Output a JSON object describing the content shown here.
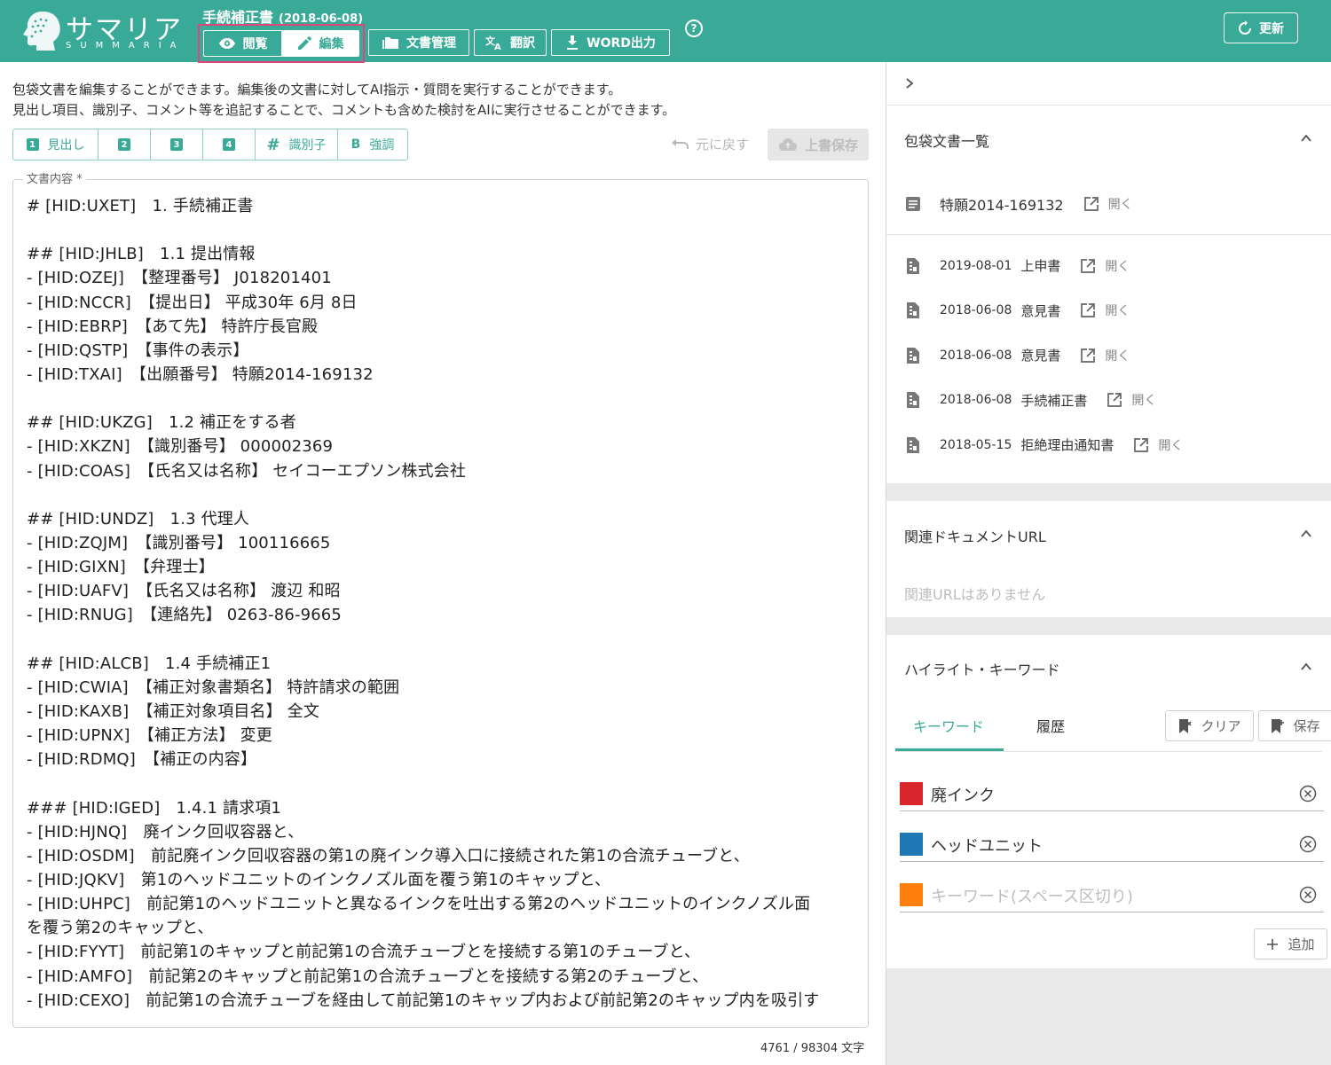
{
  "header": {
    "logo_main": "サマリア",
    "logo_sub": "SUMMARIA",
    "doc_title": "手続補正書",
    "doc_date": "(2018-06-08)",
    "mode_view": "閲覧",
    "mode_edit": "編集",
    "btn_docs": "文書管理",
    "btn_translate": "翻訳",
    "btn_word": "WORD出力",
    "help": "?",
    "btn_update": "更新",
    "accent_color": "#3aaa98",
    "highlight_border_color": "#e0457b"
  },
  "left": {
    "desc_line1": "包袋文書を編集することができます。編集後の文書に対してAI指示・質問を実行することができます。",
    "desc_line2": "見出し項目、識別子、コメント等を追記することで、コメントも含めた検討をAIに実行させることができます。",
    "fmt": {
      "h1_num": "1",
      "h1_label": "見出し",
      "h2_num": "2",
      "h3_num": "3",
      "h4_num": "4",
      "id_symbol": "#",
      "id_label": "識別子",
      "bold_symbol": "B",
      "bold_label": "強調"
    },
    "undo_label": "元に戻す",
    "save_label": "上書保存",
    "editor_label": "文書内容 *",
    "editor_lines": [
      "# [HID:UXET]　1. 手続補正書",
      "",
      "## [HID:JHLB]　1.1 提出情報",
      "- [HID:OZEJ]　【整理番号】 J018201401",
      "- [HID:NCCR]　【提出日】 平成30年 6月 8日",
      "- [HID:EBRP]　【あて先】 特許庁長官殿",
      "- [HID:QSTP]　【事件の表示】",
      "  - [HID:TXAI]　【出願番号】 特願2014-169132",
      "",
      "## [HID:UKZG]　1.2 補正をする者",
      "- [HID:XKZN]　【識別番号】 000002369",
      "- [HID:COAS]　【氏名又は名称】 セイコーエプソン株式会社",
      "",
      "## [HID:UNDZ]　1.3 代理人",
      "- [HID:ZQJM]　【識別番号】 100116665",
      "- [HID:GIXN]　【弁理士】",
      "- [HID:UAFV]　【氏名又は名称】 渡辺 和昭",
      "- [HID:RNUG]　【連絡先】 0263-86-9665",
      "",
      "## [HID:ALCB]　1.4 手続補正1",
      "- [HID:CWIA]　【補正対象書類名】 特許請求の範囲",
      "- [HID:KAXB]　【補正対象項目名】 全文",
      "- [HID:UPNX]　【補正方法】 変更",
      "- [HID:RDMQ]　【補正の内容】",
      "",
      "### [HID:IGED]　1.4.1 請求項1",
      "- [HID:HJNQ]　廃インク回収容器と、",
      "- [HID:OSDM]　前記廃インク回収容器の第1の廃インク導入口に接続された第1の合流チューブと、",
      "- [HID:JQKV]　第1のヘッドユニットのインクノズル面を覆う第1のキャップと、",
      "- [HID:UHPC]　前記第1のヘッドユニットと異なるインクを吐出する第2のヘッドユニットのインクノズル面",
      "を覆う第2のキャップと、",
      "- [HID:FYYT]　前記第1のキャップと前記第1の合流チューブとを接続する第1のチューブと、",
      "- [HID:AMFO]　前記第2のキャップと前記第1の合流チューブとを接続する第2のチューブと、",
      "- [HID:CEXO]　前記第1の合流チューブを経由して前記第1のキャップ内および前記第2のキャップ内を吸引す"
    ],
    "char_count": "4761 / 98304 文字"
  },
  "right": {
    "docs_title": "包袋文書一覧",
    "main_doc": {
      "name": "特願2014-169132",
      "open": "開く"
    },
    "docs": [
      {
        "date": "2019-08-01",
        "name": "上申書",
        "open": "開く"
      },
      {
        "date": "2018-06-08",
        "name": "意見書",
        "open": "開く"
      },
      {
        "date": "2018-06-08",
        "name": "意見書",
        "open": "開く"
      },
      {
        "date": "2018-06-08",
        "name": "手続補正書",
        "open": "開く"
      },
      {
        "date": "2018-05-15",
        "name": "拒絶理由通知書",
        "open": "開く"
      }
    ],
    "url_title": "関連ドキュメントURL",
    "no_url": "関連URLはありません",
    "hl_title": "ハイライト・キーワード",
    "tab_keyword": "キーワード",
    "tab_history": "履歴",
    "btn_clear": "クリア",
    "btn_save": "保存",
    "keywords": [
      {
        "text": "廃インク",
        "color": "#d9262c"
      },
      {
        "text": "ヘッドユニット",
        "color": "#1f77b4"
      }
    ],
    "keyword_placeholder": "キーワード(スペース区切り)",
    "placeholder_color": "#ff7f0e",
    "btn_add": "追加"
  }
}
